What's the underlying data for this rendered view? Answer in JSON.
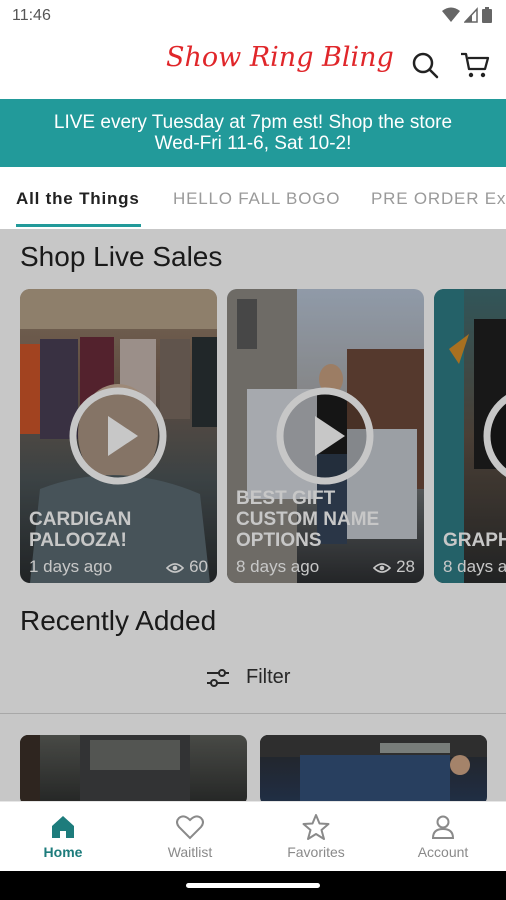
{
  "status": {
    "time": "11:46"
  },
  "header": {
    "logo_text": "Show Ring Bling"
  },
  "banner": {
    "line1": "LIVE every Tuesday at 7pm est! Shop the store",
    "line2": "Wed-Fri 11-6, Sat 10-2!"
  },
  "tabs": [
    {
      "label": "All the Things",
      "active": true
    },
    {
      "label": "HELLO FALL BOGO",
      "active": false
    },
    {
      "label": "PRE ORDER Ex",
      "active": false
    }
  ],
  "live_sales": {
    "title": "Shop Live Sales",
    "cards": [
      {
        "title": "CARDIGAN PALOOZA!",
        "age": "1 days ago",
        "views": "60"
      },
      {
        "title": "BEST GIFT CUSTOM NAME OPTIONS",
        "age": "8 days ago",
        "views": "28"
      },
      {
        "title": "Graphic",
        "age": "8 days a",
        "views": ""
      }
    ]
  },
  "recently_added": {
    "title": "Recently Added",
    "filter_label": "Filter"
  },
  "bottom_nav": [
    {
      "label": "Home",
      "icon": "home-icon",
      "active": true
    },
    {
      "label": "Waitlist",
      "icon": "heart-icon",
      "active": false
    },
    {
      "label": "Favorites",
      "icon": "star-icon",
      "active": false
    },
    {
      "label": "Account",
      "icon": "person-icon",
      "active": false
    }
  ],
  "colors": {
    "teal": "#229a9a",
    "logo_red": "#e0262a",
    "active_nav": "#1d7c7c"
  }
}
